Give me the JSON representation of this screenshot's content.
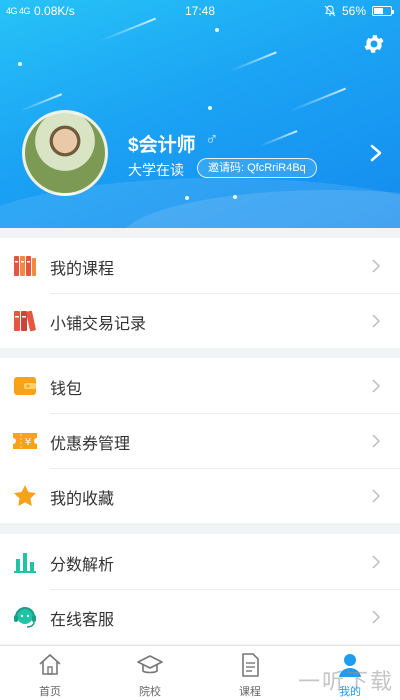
{
  "status_bar": {
    "signal": "4G 4G",
    "net_speed": "0.08K/s",
    "time": "17:48",
    "battery": "56%",
    "battery_level": 0.56
  },
  "header": {
    "username": "$会计师",
    "gender_symbol": "♂",
    "school": "大学在读",
    "invite_code": "邀请码: QfcRriR4Bq"
  },
  "menu_groups": [
    [
      {
        "label": "我的课程",
        "icon": "books-icon",
        "color": "#e8553f"
      },
      {
        "label": "小铺交易记录",
        "icon": "books-red-icon",
        "color": "#e8553f"
      }
    ],
    [
      {
        "label": "钱包",
        "icon": "wallet-icon",
        "color": "#f7a21b"
      },
      {
        "label": "优惠券管理",
        "icon": "coupon-icon",
        "color": "#f7a21b"
      },
      {
        "label": "我的收藏",
        "icon": "star-icon",
        "color": "#f7a21b"
      }
    ],
    [
      {
        "label": "分数解析",
        "icon": "bar-chart-icon",
        "color": "#1fc3a5"
      },
      {
        "label": "在线客服",
        "icon": "headset-icon",
        "color": "#1fc3a5"
      }
    ]
  ],
  "tabs": [
    {
      "label": "首页",
      "icon": "home-icon",
      "active": false
    },
    {
      "label": "院校",
      "icon": "graduation-cap-icon",
      "active": false
    },
    {
      "label": "课程",
      "icon": "document-icon",
      "active": false
    },
    {
      "label": "我的",
      "icon": "person-icon",
      "active": true
    }
  ],
  "colors": {
    "accent": "#1e9cf0",
    "header_start": "#27c3f7",
    "header_end": "#148bef"
  },
  "watermark": "一听下载"
}
